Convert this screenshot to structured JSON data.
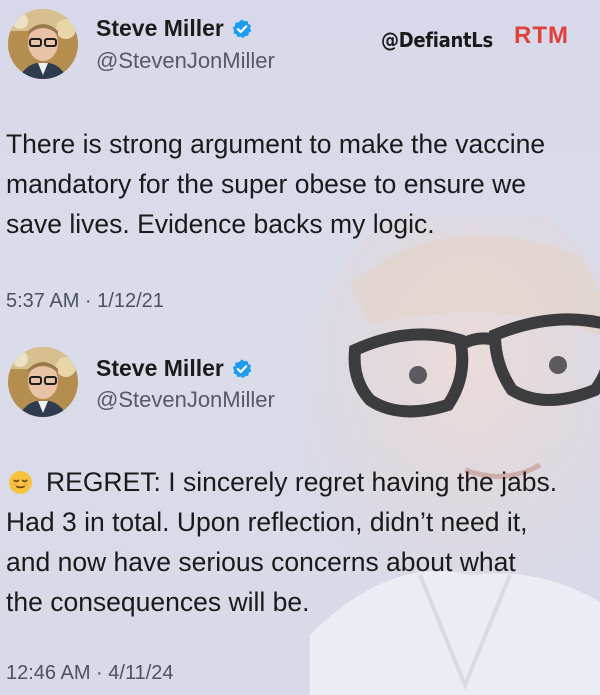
{
  "watermark": {
    "handle": "@DefiantLs",
    "logo": "RTM"
  },
  "tweets": [
    {
      "display_name": "Steve Miller",
      "username": "@StevenJonMiller",
      "verified_icon": "verified-badge-icon",
      "text": "There is strong argument to make the vaccine\nmandatory for the super obese to ensure we\nsave lives. Evidence backs my logic.",
      "timestamp": "5:37 AM · 1/12/21"
    },
    {
      "display_name": "Steve Miller",
      "username": "@StevenJonMiller",
      "verified_icon": "verified-badge-icon",
      "emoji": "relieved-face-icon",
      "text": "REGRET: I sincerely regret having the jabs.\nHad 3 in total. Upon reflection, didn’t need it,\nand now have serious concerns about what\nthe consequences will be.",
      "timestamp": "12:46 AM · 4/11/24"
    }
  ],
  "colors": {
    "background": "#d9dbe9",
    "verified_blue": "#1d9bf0",
    "logo_red": "#e0413a",
    "text": "#1a1a1a",
    "secondary_text": "#555a66"
  }
}
